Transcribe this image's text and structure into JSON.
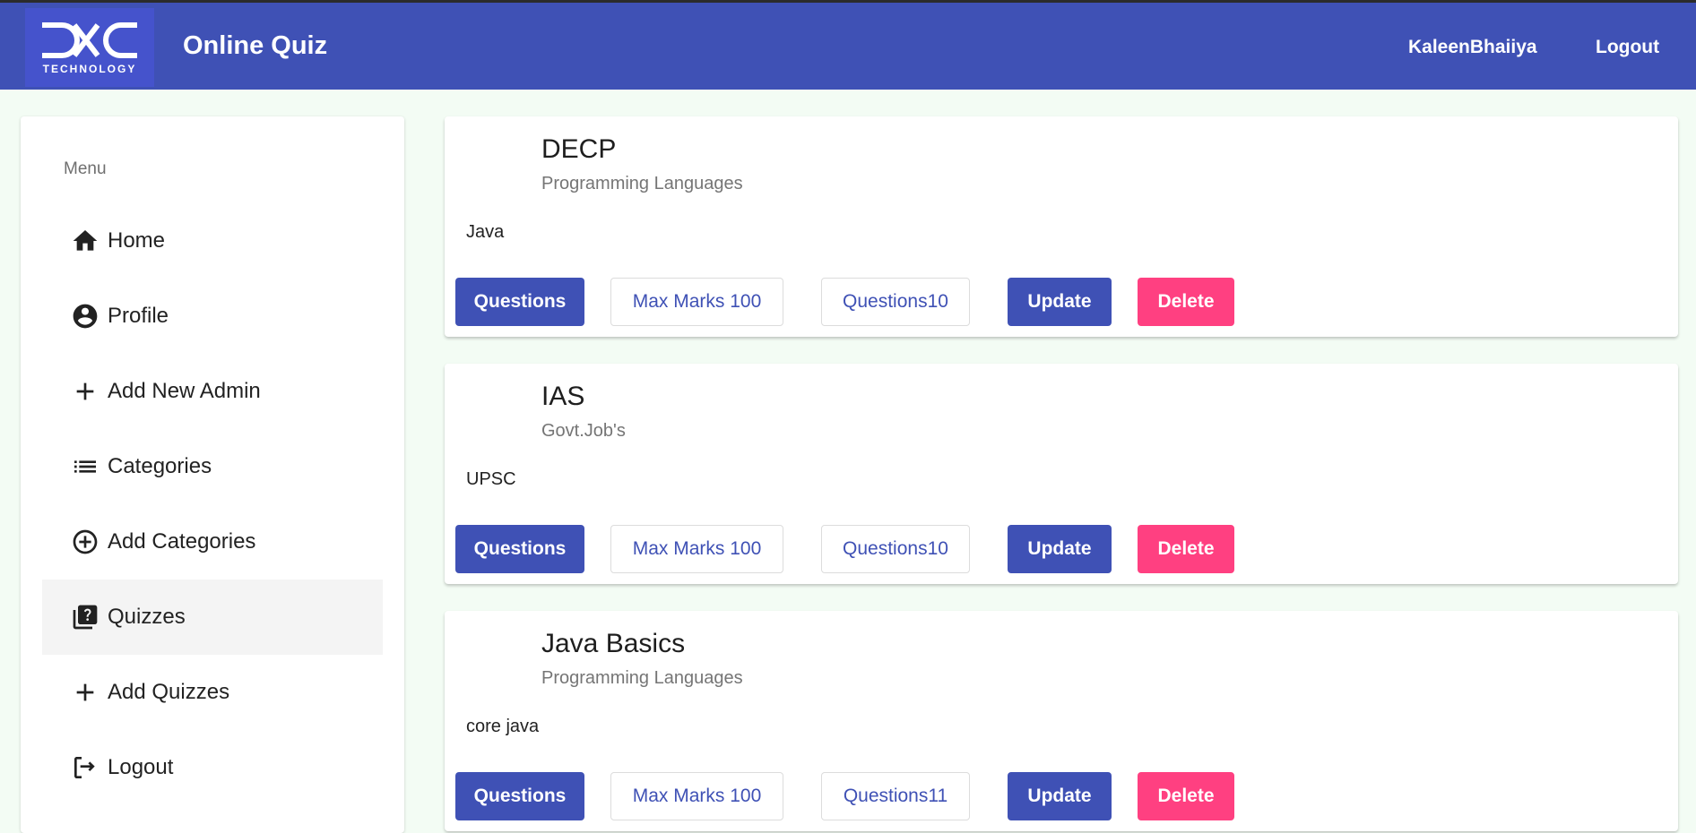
{
  "header": {
    "logo_text": "DXC",
    "logo_sub": "TECHNOLOGY",
    "title": "Online Quiz",
    "user": "KaleenBhaiiya",
    "logout": "Logout"
  },
  "sidebar": {
    "heading": "Menu",
    "items": [
      {
        "label": "Home",
        "icon": "home-icon"
      },
      {
        "label": "Profile",
        "icon": "account-circle-icon"
      },
      {
        "label": "Add New Admin",
        "icon": "plus-icon"
      },
      {
        "label": "Categories",
        "icon": "list-icon"
      },
      {
        "label": "Add Categories",
        "icon": "add-circle-icon"
      },
      {
        "label": "Quizzes",
        "icon": "quiz-icon",
        "active": true
      },
      {
        "label": "Add Quizzes",
        "icon": "plus-icon"
      },
      {
        "label": "Logout",
        "icon": "logout-icon"
      }
    ]
  },
  "quizzes": [
    {
      "title": "DECP",
      "category": "Programming Languages",
      "description": "Java",
      "questions_btn": "Questions",
      "max_marks": "Max Marks 100",
      "question_count": "Questions10",
      "update_btn": "Update",
      "delete_btn": "Delete"
    },
    {
      "title": "IAS",
      "category": "Govt.Job's",
      "description": "UPSC",
      "questions_btn": "Questions",
      "max_marks": "Max Marks 100",
      "question_count": "Questions10",
      "update_btn": "Update",
      "delete_btn": "Delete"
    },
    {
      "title": "Java Basics",
      "category": "Programming Languages",
      "description": "core java",
      "questions_btn": "Questions",
      "max_marks": "Max Marks 100",
      "question_count": "Questions11",
      "update_btn": "Update",
      "delete_btn": "Delete"
    }
  ],
  "colors": {
    "primary": "#3f51b5",
    "accent": "#ff4081",
    "background": "#f3fcf4"
  }
}
